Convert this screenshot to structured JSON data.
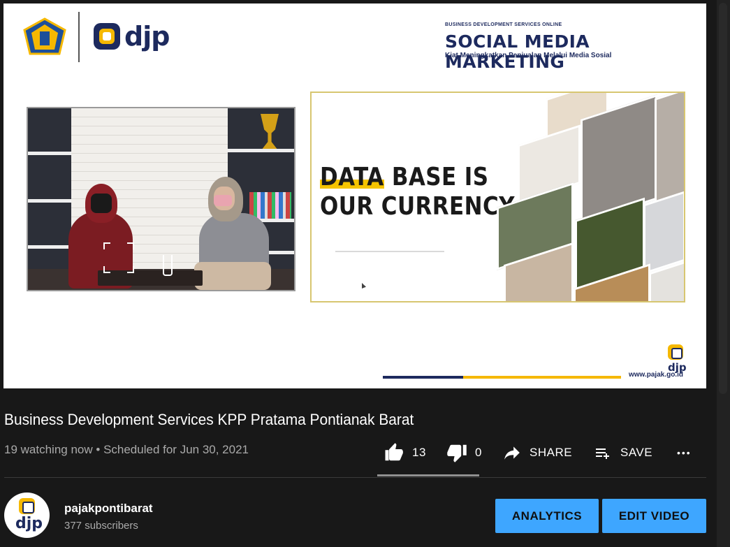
{
  "slide": {
    "djp_logo_text": "djp",
    "header_kicker": "BUSINESS DEVELOPMENT SERVICES ONLINE",
    "header_title": "SOCIAL MEDIA MARKETING",
    "header_subtitle": "Kiat Meningkatkan Penjualan Melalui Media Sosial",
    "slide_title_line1": "DATA BASE IS",
    "slide_title_line2": "OUR CURRENCY",
    "corner_logo_text": "djp",
    "website": "www.pajak.go.id",
    "colors": {
      "navy": "#1d2a5e",
      "gold": "#f5b800",
      "slide_border": "#d7c670"
    }
  },
  "video": {
    "title": "Business Development Services KPP Pratama Pontianak Barat",
    "watching": "19 watching now",
    "bullet": "•",
    "scheduled": "Scheduled for Jun 30, 2021"
  },
  "actions": {
    "like_count": "13",
    "dislike_count": "0",
    "share_label": "SHARE",
    "save_label": "SAVE",
    "more_label": "•••"
  },
  "channel": {
    "avatar_text": "djp",
    "name": "pajakpontibarat",
    "subscribers": "377 subscribers"
  },
  "buttons": {
    "analytics": "ANALYTICS",
    "edit_video": "EDIT VIDEO",
    "color": "#3ea6ff"
  }
}
